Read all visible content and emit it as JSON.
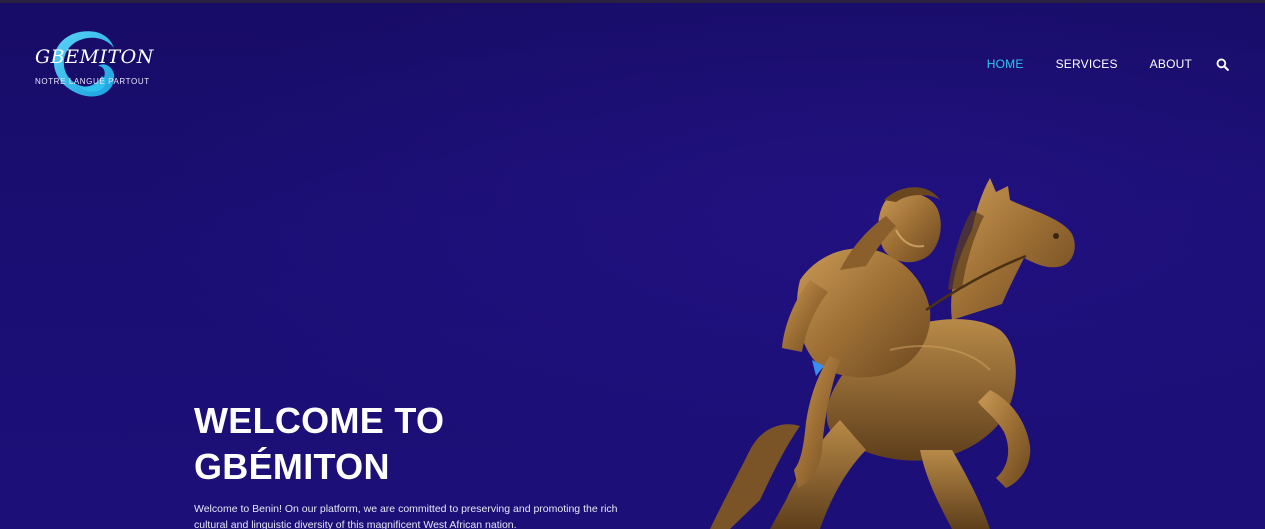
{
  "brand": {
    "name": "GBEMITON",
    "tagline": "NOTRE LANGUE PARTOUT",
    "accent": "#2ec4f0"
  },
  "nav": {
    "items": [
      {
        "label": "HOME",
        "active": true
      },
      {
        "label": "SERVICES",
        "active": false
      },
      {
        "label": "ABOUT",
        "active": false
      }
    ],
    "search_icon": "search-icon"
  },
  "hero": {
    "title_line1": "WELCOME TO",
    "title_line2": "GBÉMITON",
    "description": "Welcome to Benin! On our platform, we are committed to preserving and promoting the rich cultural and linguistic diversity of this magnificent West African nation."
  },
  "colors": {
    "background": "#1a0d70",
    "text": "#ffffff",
    "active_nav": "#2ec4f0",
    "statue": "#a87a3c"
  }
}
